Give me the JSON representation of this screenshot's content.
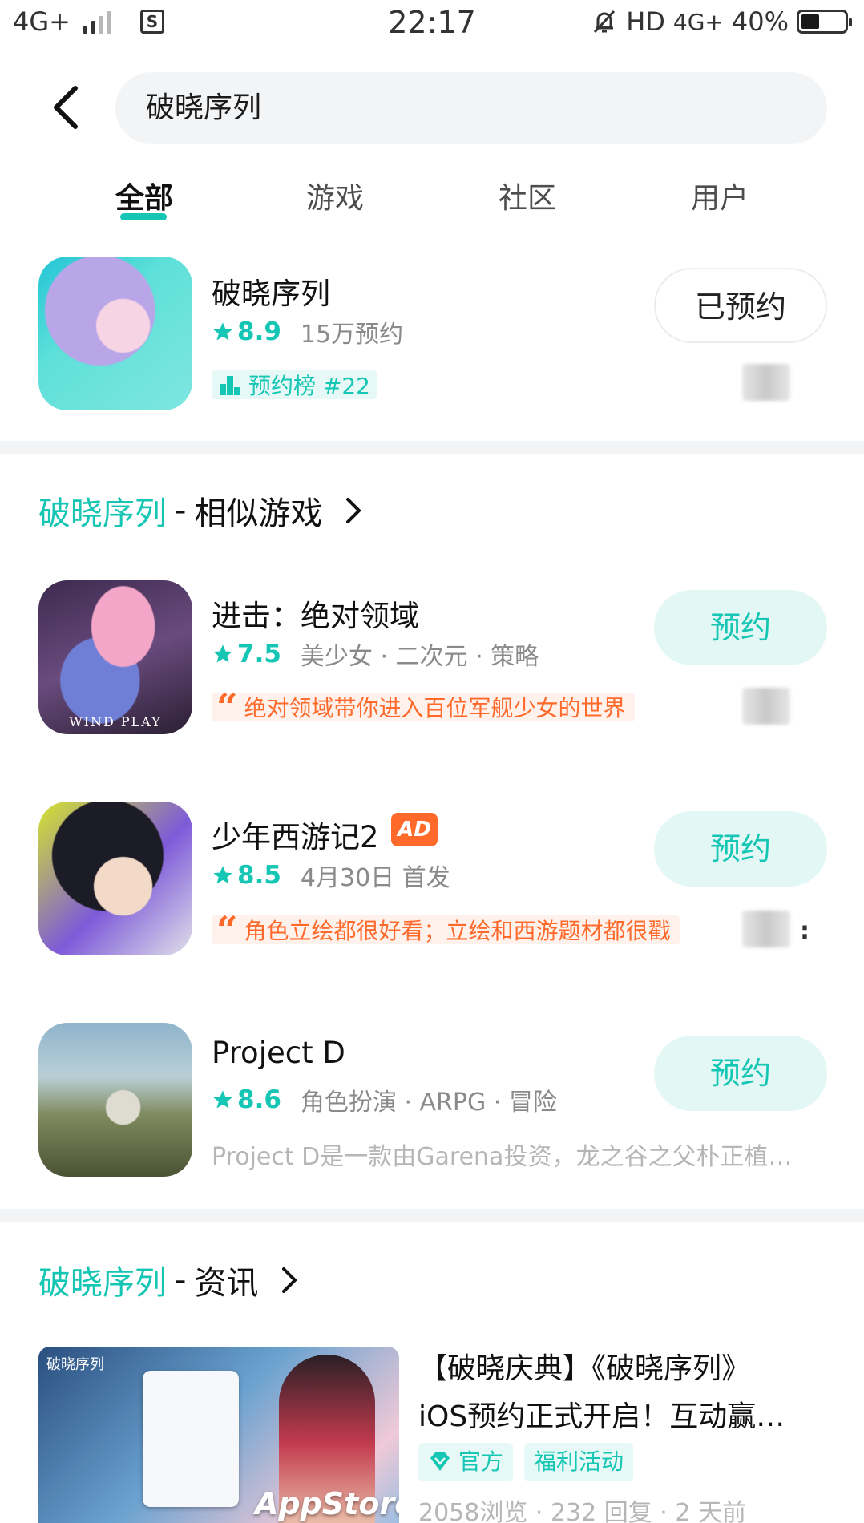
{
  "status_bar": {
    "network": "4G+",
    "time": "22:17",
    "hd": "HD",
    "network_right": "4G+",
    "battery": "40%",
    "battery_level": 0.4
  },
  "search": {
    "query": "破晓序列"
  },
  "tabs": [
    {
      "label": "全部",
      "active": true
    },
    {
      "label": "游戏",
      "active": false
    },
    {
      "label": "社区",
      "active": false
    },
    {
      "label": "用户",
      "active": false
    }
  ],
  "top_result": {
    "name": "破晓序列",
    "rating": "8.9",
    "reservations": "15万预约",
    "rank_label": "预约榜 #22",
    "button": "已预约"
  },
  "similar_section": {
    "highlight": "破晓序列",
    "separator": "-",
    "title": "相似游戏"
  },
  "similar_games": [
    {
      "name": "进击：绝对领域",
      "rating": "7.5",
      "tags": "美少女 · 二次元 · 策略",
      "quote": "绝对领域带你进入百位军舰少女的世界",
      "icon_caption": "WIND PLAY",
      "button": "预约"
    },
    {
      "name": "少年西游记2",
      "ad": "AD",
      "rating": "8.5",
      "tags": "4月30日 首发",
      "quote": "角色立绘都很好看；立绘和西游题材都很戳",
      "button": "预约"
    },
    {
      "name": "Project D",
      "rating": "8.6",
      "tags": "角色扮演 · ARPG · 冒险",
      "desc": "Project D是一款由Garena投资，龙之谷之父朴正植…",
      "button": "预约"
    }
  ],
  "news_section": {
    "highlight": "破晓序列",
    "separator": "-",
    "title": "资讯"
  },
  "news": {
    "title_line1": "【破晓庆典】《破晓序列》",
    "title_line2": "iOS预约正式开启！互动赢…",
    "tags": [
      "官方",
      "福利活动"
    ],
    "stats": "2058浏览 · 232 回复 · 2 天前",
    "thumb_logo": "破晓序列",
    "thumb_store": "AppStore"
  },
  "colors": {
    "accent": "#14c6b3",
    "quote": "#ff6a2b",
    "divider": "#f3f4f6"
  }
}
